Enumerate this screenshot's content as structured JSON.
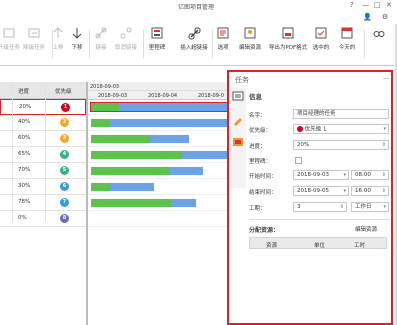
{
  "window": {
    "title": "亿图项目管理"
  },
  "ribbon": {
    "buttons": [
      {
        "label": "升级任务",
        "icon": "outdent-icon",
        "enabled": false
      },
      {
        "label": "降级任务",
        "icon": "indent-icon",
        "enabled": false
      },
      {
        "label": "上移",
        "icon": "arrow-up-icon",
        "enabled": false
      },
      {
        "label": "下移",
        "icon": "arrow-down-icon",
        "enabled": true
      },
      {
        "label": "链接",
        "icon": "link-icon",
        "enabled": false
      },
      {
        "label": "取消链接",
        "icon": "unlink-icon",
        "enabled": false
      },
      {
        "label": "里程碑",
        "icon": "milestone-icon",
        "enabled": true
      },
      {
        "label": "插入超链接",
        "icon": "hyperlink-icon",
        "enabled": true
      },
      {
        "label": "选项",
        "icon": "options-icon",
        "enabled": true
      },
      {
        "label": "编辑资源",
        "icon": "edit-resource-icon",
        "enabled": true
      },
      {
        "label": "导出为PDF格式",
        "icon": "pdf-icon",
        "enabled": true
      },
      {
        "label": "选中的",
        "icon": "selected-icon",
        "enabled": true
      },
      {
        "label": "今天的",
        "icon": "today-icon",
        "enabled": true
      }
    ]
  },
  "grid": {
    "headers": [
      "进度",
      "优先级"
    ],
    "rows": [
      {
        "progress": "20%",
        "priority": "1",
        "color": "#d3001e"
      },
      {
        "progress": "40%",
        "priority": "2",
        "color": "#f5a623"
      },
      {
        "progress": "60%",
        "priority": "3",
        "color": "#f5a623"
      },
      {
        "progress": "65%",
        "priority": "4",
        "color": "#3bb08f"
      },
      {
        "progress": "70%",
        "priority": "5",
        "color": "#3bb08f"
      },
      {
        "progress": "30%",
        "priority": "6",
        "color": "#3a9ad9"
      },
      {
        "progress": "78%",
        "priority": "7",
        "color": "#3a9ad9"
      },
      {
        "progress": "0%",
        "priority": "8",
        "color": "#6a6abf"
      }
    ]
  },
  "gantt": {
    "week_label": "2018-09-03",
    "days": [
      "2018-09-03",
      "2018-09-04",
      "2018-09-0"
    ],
    "bars": [
      {
        "start": 0.02,
        "length": 1.0,
        "done": 0.2
      },
      {
        "start": 0.02,
        "length": 1.0,
        "done": 0.13
      },
      {
        "start": 0.02,
        "length": 0.7,
        "done": 0.42
      },
      {
        "start": 0.02,
        "length": 1.0,
        "done": 0.65
      },
      {
        "start": 0.02,
        "length": 0.8,
        "done": 0.56
      },
      {
        "start": 0.02,
        "length": 0.45,
        "done": 0.14
      },
      {
        "start": 0.02,
        "length": 0.75,
        "done": 0.58
      },
      {
        "start": 0.02,
        "length": 0.0,
        "done": 0.0
      }
    ]
  },
  "panel": {
    "title": "任务",
    "section": "信息",
    "fields": {
      "name_label": "名字：",
      "name_value": "项目经理的任务",
      "priority_label": "优先级：",
      "priority_value": "优先级 1",
      "progress_label": "进度：",
      "progress_value": "20%",
      "milestone_label": "里程碑：",
      "start_label": "开始时间：",
      "start_date": "2018-09-03",
      "start_time": "08:00",
      "end_label": "结束时间：",
      "end_date": "2018-09-05",
      "end_time": "16:00",
      "duration_label": "工期：",
      "duration_value": "3",
      "duration_unit": "工作日"
    },
    "assign": {
      "title": "分配资源：",
      "edit": "编辑资源",
      "columns": [
        "资源",
        "单位",
        "工时"
      ]
    }
  }
}
